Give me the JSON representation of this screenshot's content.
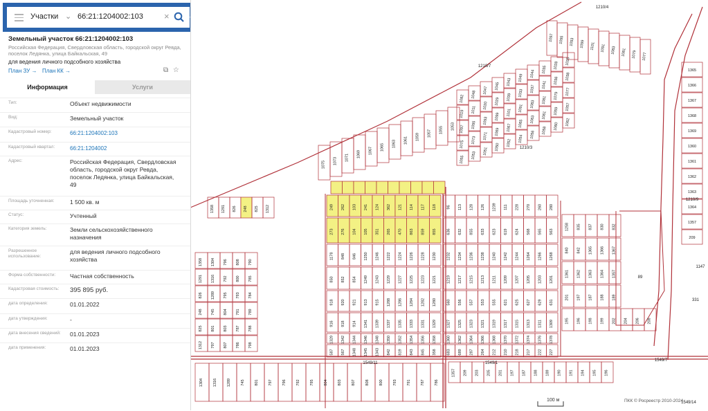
{
  "search": {
    "layer_label": "Участки",
    "query": "66:21:1204002:103"
  },
  "parcel": {
    "title": "Земельный участок 66:21:1204002:103",
    "address_short": "Российская Федерация, Свердловская область, городской округ Ревда, поселок Ледянка, улица Байкальская, 49",
    "purpose": "для ведения личного подсобного хозяйства",
    "plan_zu": "План ЗУ →",
    "plan_kk": "План КК →"
  },
  "tabs": {
    "info": "Информация",
    "services": "Услуги"
  },
  "info_rows": [
    {
      "label": "Тип:",
      "value": "Объект недвижимости"
    },
    {
      "label": "Вид:",
      "value": "Земельный участок"
    },
    {
      "label": "Кадастровый номер:",
      "value": "66:21:1204002:103"
    },
    {
      "label": "Кадастровый квартал:",
      "value": "66:21:1204002"
    },
    {
      "label": "Адрес:",
      "value": "Российская Федерация, Свердловская область, городской округ Ревда, поселок Ледянка, улица Байкальская, 49"
    },
    {
      "label": "Площадь уточненная:",
      "value": "1 500 кв. м"
    },
    {
      "label": "Статус:",
      "value": "Учтенный"
    },
    {
      "label": "Категория земель:",
      "value": "Земли сельскохозяйственного назначения"
    },
    {
      "label": "Разрешенное использование:",
      "value": "для ведения личного подсобного хозяйства"
    },
    {
      "label": "Форма собственности:",
      "value": "Частная собственность"
    },
    {
      "label": "Кадастровая стоимость:",
      "value": "395 895 руб."
    },
    {
      "label": "дата определения:",
      "value": "01.01.2022"
    },
    {
      "label": "дата утверждения:",
      "value": "-"
    },
    {
      "label": "дата внесения сведений:",
      "value": "01.01.2023"
    },
    {
      "label": "дата применения:",
      "value": "01.01.2023"
    }
  ],
  "map": {
    "scale_label": "100 м",
    "credit": "ПКК © Росреестр 2010-2024",
    "line_color": "#b03038",
    "highlight_color": "#f3f184",
    "street_labels": [
      "1210/4",
      "1210/7",
      "1210/3",
      "1210/9",
      "1549/11",
      "1549/1",
      "1549/7",
      "1549/14"
    ],
    "big_parcels": [
      "89",
      "331",
      "1147"
    ],
    "highlighted_parcels": [
      "103",
      "104",
      "105",
      "106",
      "107",
      "108",
      "109",
      "110",
      "111"
    ],
    "grid_blocks": [
      {
        "labels": [
          "249",
          "262",
          "103",
          "241",
          "124",
          "362",
          "121",
          "114",
          "117",
          "118",
          "96",
          "113",
          "128",
          "126",
          "1239",
          "111",
          "228",
          "270",
          "260",
          "280"
        ]
      },
      {
        "labels": [
          "273",
          "276",
          "104",
          "105",
          "351",
          "265",
          "470",
          "863",
          "859",
          "855",
          "636",
          "632",
          "855",
          "633",
          "623",
          "619",
          "624",
          "568",
          "565",
          "563"
        ]
      },
      {
        "labels": [
          "1178",
          "848",
          "846",
          "1250",
          "1246",
          "1222",
          "1224",
          "1226",
          "1228",
          "1230",
          "1232",
          "1234",
          "1236",
          "1238",
          "1240",
          "1242",
          "1244",
          "1264",
          "1266",
          "1268"
        ]
      },
      {
        "labels": [
          "850",
          "852",
          "854",
          "1249",
          "1243",
          "1229",
          "1227",
          "1225",
          "1223",
          "1221",
          "1219",
          "1217",
          "1215",
          "1213",
          "1211",
          "1209",
          "1207",
          "1205",
          "1203",
          "1201"
        ]
      },
      {
        "labels": [
          "918",
          "920",
          "921",
          "913",
          "915",
          "1288",
          "1286",
          "1284",
          "1282",
          "1280",
          "560",
          "556",
          "557",
          "553",
          "555",
          "621",
          "625",
          "627",
          "629",
          "631"
        ]
      },
      {
        "labels": [
          "916",
          "918",
          "914",
          "1341",
          "1339",
          "1337",
          "1335",
          "1333",
          "1331",
          "1329",
          "1327",
          "1325",
          "1323",
          "1321",
          "1319",
          "1317",
          "1315",
          "1313",
          "1311",
          "1309"
        ]
      },
      {
        "labels": [
          "1329",
          "1342",
          "1344",
          "1346",
          "1348",
          "1350",
          "1352",
          "1354",
          "1356",
          "1358",
          "1360",
          "1362",
          "1364",
          "1366",
          "1368",
          "1370",
          "1372",
          "1374",
          "1376",
          "1378"
        ]
      },
      {
        "labels": [
          "587",
          "567",
          "1348",
          "1345",
          "1343",
          "842",
          "819",
          "843",
          "845",
          "358",
          "683",
          "689",
          "287",
          "264",
          "212",
          "210",
          "218",
          "217",
          "222",
          "227"
        ]
      }
    ],
    "north_labels": [
      "1082",
      "1048",
      "1047",
      "1045",
      "1043",
      "1049",
      "1044",
      "1035",
      "1028",
      "1025",
      "1019",
      "1011",
      "1020",
      "1029",
      "1039",
      "1033",
      "1037",
      "1041",
      "1036",
      "1038",
      "1097",
      "1095",
      "1093",
      "1099",
      "1101",
      "1091",
      "1083",
      "1081",
      "1079",
      "1077",
      "1075",
      "1073",
      "1071",
      "1069",
      "1067",
      "1065",
      "1063",
      "1061",
      "1059",
      "1057",
      "1055",
      "1053",
      "1051",
      "1050",
      "1052",
      "1054",
      "1056",
      "1058",
      "1060",
      "1062"
    ],
    "east_labels": [
      "1258",
      "835",
      "837",
      "830",
      "832",
      "1264",
      "836",
      "838",
      "840",
      "842",
      "1365",
      "1366",
      "1367",
      "1368",
      "1369",
      "1360",
      "1361",
      "1362",
      "1363",
      "1364",
      "1357",
      "209",
      "203",
      "205",
      "201",
      "197",
      "187",
      "188",
      "189",
      "190",
      "191",
      "194",
      "195",
      "196",
      "198",
      "199",
      "202",
      "204",
      "206",
      "208"
    ],
    "west_labels": [
      "1358",
      "1291",
      "826",
      "248",
      "825",
      "1312",
      "1304",
      "1316",
      "1289",
      "745",
      "801",
      "797",
      "796",
      "792",
      "795",
      "804",
      "803",
      "807",
      "808",
      "800",
      "793",
      "791",
      "787",
      "786",
      "790",
      "785",
      "784",
      "789",
      "788",
      "798"
    ]
  }
}
